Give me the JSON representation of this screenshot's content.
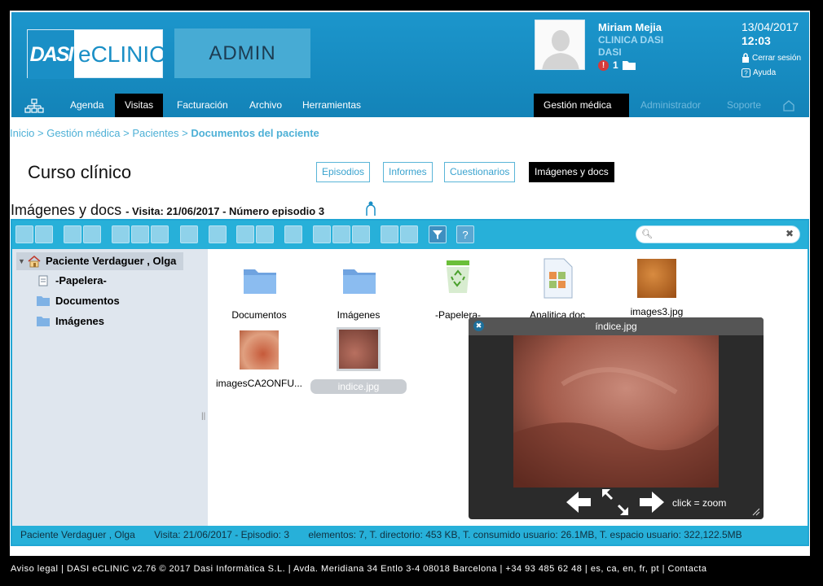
{
  "brand": {
    "logo_mark": "DASI",
    "logo_text": "eCLINIC",
    "area": "ADMIN"
  },
  "user": {
    "name": "Miriam Mejia",
    "clinic": "CLINICA DASI",
    "org": "DASI",
    "alerts": "1"
  },
  "session": {
    "date": "13/04/2017",
    "time": "12:03",
    "logout": "Cerrar sesión",
    "help": "Ayuda"
  },
  "nav": {
    "items": [
      "Agenda",
      "Visitas",
      "Facturación",
      "Archivo",
      "Herramientas"
    ],
    "active": "Visitas",
    "right": [
      "Gestión médica",
      "Administrador",
      "Soporte"
    ]
  },
  "breadcrumb": {
    "items": [
      "Inicio",
      "Gestión médica",
      "Pacientes"
    ],
    "current": "Documentos del paciente",
    "separator": ">"
  },
  "page": {
    "title": "Curso clínico"
  },
  "tabs": [
    "Episodios",
    "Informes",
    "Cuestionarios",
    "Imágenes y docs"
  ],
  "section": {
    "title": "Imágenes y docs",
    "visit": "- Visita: 21/06/2017 - Número episodio 3"
  },
  "tree": {
    "root": "Paciente Verdaguer , Olga",
    "items": [
      "-Papelera-",
      "Documentos",
      "Imágenes"
    ]
  },
  "files": [
    {
      "name": "Documentos",
      "icon": "folder-icon"
    },
    {
      "name": "Imágenes",
      "icon": "folder-icon"
    },
    {
      "name": "-Papelera-",
      "icon": "recycle-bin-icon"
    },
    {
      "name": "Analitica.doc",
      "icon": "document-icon"
    },
    {
      "name": "images3.jpg",
      "icon": "image-thumbnail"
    },
    {
      "name": "imagesCA2ONFU...",
      "icon": "image-thumbnail"
    },
    {
      "name": "indice.jpg",
      "icon": "image-thumbnail"
    }
  ],
  "viewer": {
    "title": "índice.jpg",
    "hint": "click = zoom"
  },
  "status": {
    "patient": "Paciente Verdaguer , Olga",
    "visit": "Visita: 21/06/2017 - Episodio: 3",
    "stats": "elementos: 7, T. directorio: 453 KB, T. consumido usuario: 26.1MB, T. espacio usuario: 322,122.5MB"
  },
  "footer": "Aviso legal | DASI eCLINIC v2.76 © 2017 Dasi Informàtica S.L. | Avda. Meridiana 34 Entlo 3-4 08018 Barcelona | +34 93 485 62 48 | es, ca, en, fr, pt | Contacta",
  "colors": {
    "accent": "#1a8fc6",
    "toolbar": "#27b0d9",
    "active": "#000000"
  }
}
